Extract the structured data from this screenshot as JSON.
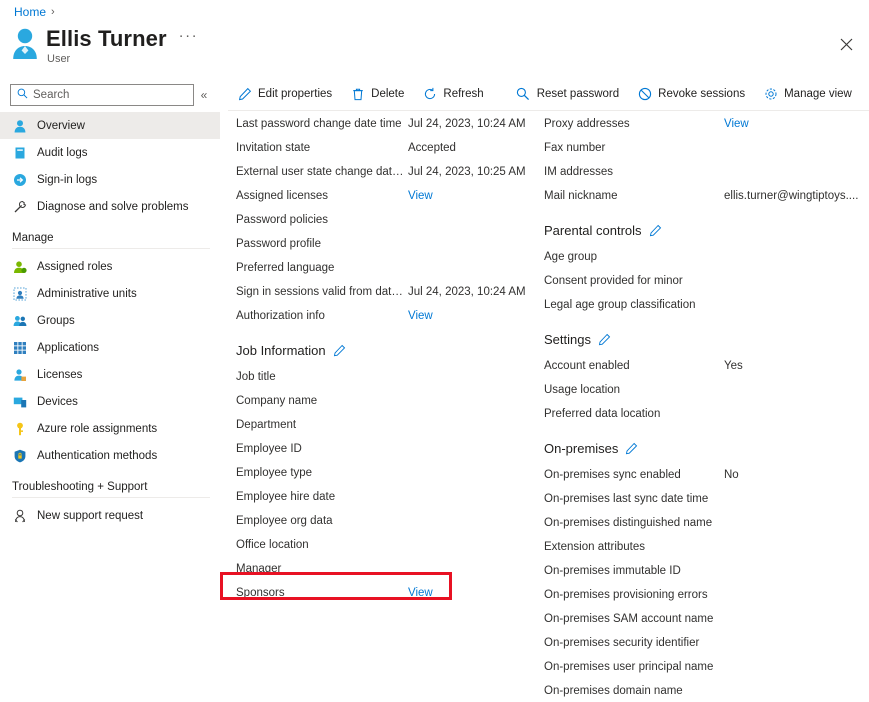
{
  "breadcrumb": {
    "home": "Home",
    "separator": "›"
  },
  "header": {
    "title": "Ellis Turner",
    "subtitle": "User",
    "ellipsis": "···",
    "avatar_icon": "user-avatar-icon",
    "close_icon": "close-icon"
  },
  "sidebar": {
    "search": {
      "placeholder": "Search",
      "value": "",
      "icon": "search-icon"
    },
    "collapse_icon": "«",
    "items": [
      {
        "label": "Overview",
        "icon": "user-icon",
        "active": true
      },
      {
        "label": "Audit logs",
        "icon": "audit-log-icon",
        "active": false
      },
      {
        "label": "Sign-in logs",
        "icon": "sign-in-icon",
        "active": false
      },
      {
        "label": "Diagnose and solve problems",
        "icon": "wrench-icon",
        "active": false
      }
    ],
    "manage_group": "Manage",
    "manage_items": [
      {
        "label": "Assigned roles",
        "icon": "assigned-roles-icon"
      },
      {
        "label": "Administrative units",
        "icon": "administrative-units-icon"
      },
      {
        "label": "Groups",
        "icon": "groups-icon"
      },
      {
        "label": "Applications",
        "icon": "applications-icon"
      },
      {
        "label": "Licenses",
        "icon": "licenses-icon"
      },
      {
        "label": "Devices",
        "icon": "devices-icon"
      },
      {
        "label": "Azure role assignments",
        "icon": "key-icon"
      },
      {
        "label": "Authentication methods",
        "icon": "shield-lock-icon"
      }
    ],
    "support_group": "Troubleshooting + Support",
    "support_items": [
      {
        "label": "New support request",
        "icon": "support-person-icon"
      }
    ]
  },
  "toolbar": {
    "buttons": [
      {
        "label": "Edit properties",
        "icon": "pencil-icon"
      },
      {
        "label": "Delete",
        "icon": "trash-icon"
      },
      {
        "label": "Refresh",
        "icon": "refresh-icon"
      },
      {
        "label": "Reset password",
        "icon": "magnifier-key-icon"
      },
      {
        "label": "Revoke sessions",
        "icon": "block-icon"
      },
      {
        "label": "Manage view",
        "icon": "gear-icon"
      }
    ],
    "overflow": "···"
  },
  "left_column": {
    "properties": [
      {
        "key": "Last password change date time",
        "value": "Jul 24, 2023, 10:24 AM",
        "link": false
      },
      {
        "key": "Invitation state",
        "value": "Accepted",
        "link": false
      },
      {
        "key": "External user state change date ...",
        "value": "Jul 24, 2023, 10:25 AM",
        "link": false
      },
      {
        "key": "Assigned licenses",
        "value": "View",
        "link": true
      },
      {
        "key": "Password policies",
        "value": "",
        "link": false
      },
      {
        "key": "Password profile",
        "value": "",
        "link": false
      },
      {
        "key": "Preferred language",
        "value": "",
        "link": false
      },
      {
        "key": "Sign in sessions valid from date ...",
        "value": "Jul 24, 2023, 10:24 AM",
        "link": false
      },
      {
        "key": "Authorization info",
        "value": "View",
        "link": true
      }
    ],
    "job_section": {
      "title": "Job Information",
      "edit_icon": "pencil-icon"
    },
    "job_properties": [
      {
        "key": "Job title",
        "value": "",
        "link": false
      },
      {
        "key": "Company name",
        "value": "",
        "link": false
      },
      {
        "key": "Department",
        "value": "",
        "link": false
      },
      {
        "key": "Employee ID",
        "value": "",
        "link": false
      },
      {
        "key": "Employee type",
        "value": "",
        "link": false
      },
      {
        "key": "Employee hire date",
        "value": "",
        "link": false
      },
      {
        "key": "Employee org data",
        "value": "",
        "link": false
      },
      {
        "key": "Office location",
        "value": "",
        "link": false
      },
      {
        "key": "Manager",
        "value": "",
        "link": false
      },
      {
        "key": "Sponsors",
        "value": "View",
        "link": true
      }
    ]
  },
  "right_column": {
    "properties": [
      {
        "key": "Proxy addresses",
        "value": "View",
        "link": true
      },
      {
        "key": "Fax number",
        "value": "",
        "link": false
      },
      {
        "key": "IM addresses",
        "value": "",
        "link": false
      },
      {
        "key": "Mail nickname",
        "value": "ellis.turner@wingtiptoys....",
        "link": false
      }
    ],
    "parental_section": {
      "title": "Parental controls",
      "edit_icon": "pencil-icon"
    },
    "parental_properties": [
      {
        "key": "Age group",
        "value": "",
        "link": false
      },
      {
        "key": "Consent provided for minor",
        "value": "",
        "link": false
      },
      {
        "key": "Legal age group classification",
        "value": "",
        "link": false
      }
    ],
    "settings_section": {
      "title": "Settings",
      "edit_icon": "pencil-icon"
    },
    "settings_properties": [
      {
        "key": "Account enabled",
        "value": "Yes",
        "link": false
      },
      {
        "key": "Usage location",
        "value": "",
        "link": false
      },
      {
        "key": "Preferred data location",
        "value": "",
        "link": false
      }
    ],
    "onprem_section": {
      "title": "On-premises",
      "edit_icon": "pencil-icon"
    },
    "onprem_properties": [
      {
        "key": "On-premises sync enabled",
        "value": "No",
        "link": false
      },
      {
        "key": "On-premises last sync date time",
        "value": "",
        "link": false
      },
      {
        "key": "On-premises distinguished name",
        "value": "",
        "link": false
      },
      {
        "key": "Extension attributes",
        "value": "",
        "link": false
      },
      {
        "key": "On-premises immutable ID",
        "value": "",
        "link": false
      },
      {
        "key": "On-premises provisioning errors",
        "value": "",
        "link": false
      },
      {
        "key": "On-premises SAM account name",
        "value": "",
        "link": false
      },
      {
        "key": "On-premises security identifier",
        "value": "",
        "link": false
      },
      {
        "key": "On-premises user principal name",
        "value": "",
        "link": false
      },
      {
        "key": "On-premises domain name",
        "value": "",
        "link": false
      }
    ]
  },
  "highlight": {
    "target": "Sponsors",
    "color": "#e81123"
  },
  "colors": {
    "accent": "#0078d4",
    "highlight": "#e81123",
    "selected_bg": "#edebe9"
  }
}
